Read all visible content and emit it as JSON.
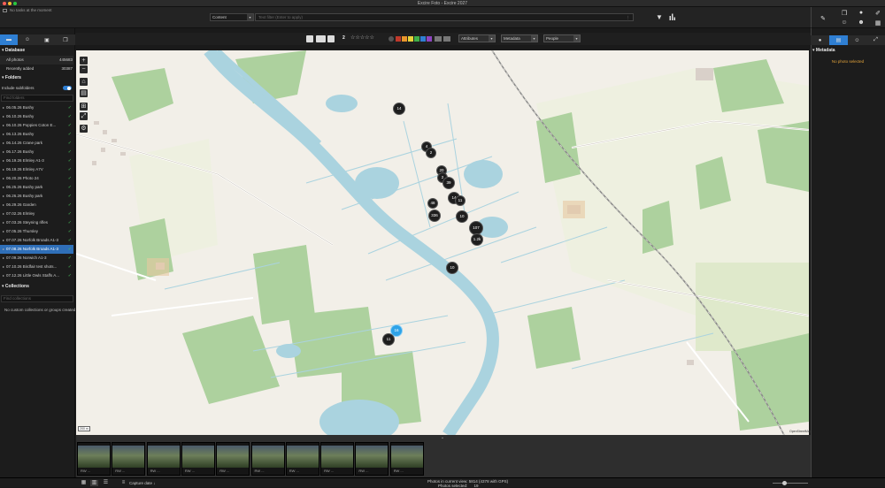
{
  "window": {
    "title": "Excire Foto - Excire 2027",
    "lights": [
      "#ff5f57",
      "#febc2e",
      "#28c840"
    ]
  },
  "topbar": {
    "tasks": "No tasks at the moment",
    "search_type": "Content",
    "search_placeholder": "Text filter (Enter to apply)"
  },
  "filterbar": {
    "rating_count": "2",
    "stars": "☆☆☆☆☆",
    "color_labels": [
      "#c0392b",
      "#e8952b",
      "#e6d23b",
      "#3fae4a",
      "#2f7fd3",
      "#8e44c0"
    ],
    "attributes": "Attributes",
    "metadata": "Metadata",
    "people": "People"
  },
  "sidebar": {
    "database": {
      "header": "Database",
      "rows": [
        {
          "label": "All photos",
          "count": "445683"
        },
        {
          "label": "Recently added",
          "count": "30387"
        }
      ]
    },
    "folders": {
      "header": "Folders",
      "include_subfolders": "Include subfolders",
      "filter_placeholder": "Find folders",
      "items": [
        "06.05.26 Bushy",
        "06.10.26 Bushy",
        "06.10.26 Poppies Coton E...",
        "06.13.26 Bushy",
        "06.14.26 Crane park",
        "06.17.26 Bushy",
        "06.19.26 Elmley A1-3",
        "06.19.26 Elmley A7V",
        "06.20.26 Photo 24",
        "06.25.26 Bushy park",
        "06.26.26 Bushy park",
        "06.29.26 Garden",
        "07.02.26 Elmley",
        "07.03.26 Steyning rifles",
        "07.05.26 Thursley",
        "07.07.26 Norfolk Broads A1-3",
        "07.08.26 Norfolk Broads A1-3",
        "07.09.26 Norwich A1-3",
        "07.10.26 Birdfair test shots...",
        "07.12.26 Little Owls Staffs A..."
      ],
      "selected_index": 16
    },
    "collections": {
      "header": "Collections",
      "filter_placeholder": "Find collections",
      "empty": "No custom collections or groups created"
    }
  },
  "map": {
    "scale": "200 m",
    "attribution": "OpenStreetMap",
    "clusters": [
      "14",
      "4",
      "2",
      "20",
      "2",
      "39",
      "14",
      "11",
      "48",
      "336",
      "10",
      "107",
      "1.2k",
      "10",
      "16",
      "11"
    ]
  },
  "right_panel": {
    "header": "Metadata",
    "empty": "No photo selected"
  },
  "statusbar": {
    "capture_date": "Capture date",
    "photos_in_view_label": "Photos in current view:",
    "photos_in_view": "5814 (4378 with GPS)",
    "photos_selected_label": "Photos selected:",
    "photos_selected": "19"
  },
  "filmstrip": {
    "thumb_meta": [
      "RW ...",
      "RW ...",
      "RW ...",
      "RW ...",
      "RW ...",
      "RW ...",
      "RW ...",
      "RW ...",
      "RW ...",
      "RW ..."
    ]
  }
}
